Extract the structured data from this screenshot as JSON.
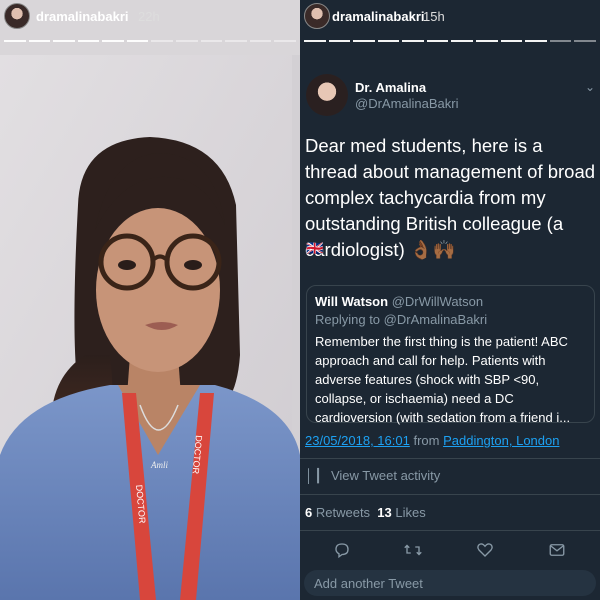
{
  "left_story": {
    "username": "dramalinabakri",
    "time": "22h",
    "photo_caption_lanyard": "DOCTOR",
    "necklace": "Amli"
  },
  "right_story": {
    "username": "dramalinabakri",
    "time": "15h"
  },
  "tweet": {
    "author_name": "Dr. Amalina",
    "author_handle": "@DrAmalinaBakri",
    "text": "Dear med students, here is a thread about management of broad complex tachycardia from my outstanding British colleague (a cardiologist) 👌🏾🙌🏾",
    "flag": "🇬🇧",
    "quoted": {
      "author_name": "Will Watson",
      "author_handle": "@DrWillWatson",
      "replying_to": "Replying to @DrAmalinaBakri",
      "text": "Remember the first thing is the patient!  ABC approach and call for help. Patients with adverse features (shock with SBP <90, collapse, or ischaemia) need a DC cardioversion (with sedation from a friend i..."
    },
    "date": "23/05/2018, 16:01",
    "from_label": "from",
    "location": "Paddington, London",
    "activity_label": "View Tweet activity",
    "retweets_count": "6",
    "retweets_label": "Retweets",
    "likes_count": "13",
    "likes_label": "Likes",
    "compose_placeholder": "Add another Tweet"
  },
  "colors": {
    "twitter_bg": "#1c2733",
    "twitter_border": "#38444d",
    "link_blue": "#1da1f2",
    "muted": "#8899a6",
    "scrub_top": "#6f8ec4",
    "lanyard": "#d8463c"
  },
  "icons": [
    "reply-icon",
    "retweet-icon",
    "like-icon",
    "dm-icon",
    "chart-icon",
    "chevron-down-icon"
  ]
}
